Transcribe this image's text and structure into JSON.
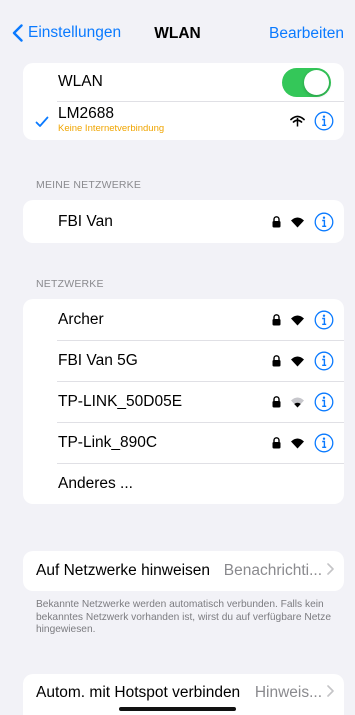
{
  "nav": {
    "back_label": "Einstellungen",
    "title": "WLAN",
    "edit_label": "Bearbeiten"
  },
  "wlan": {
    "label": "WLAN",
    "enabled": true
  },
  "connected": {
    "name": "LM2688",
    "status": "Keine Internetverbindung"
  },
  "my_networks": {
    "header": "MEINE NETZWERKE",
    "items": [
      {
        "name": "FBI Van"
      }
    ]
  },
  "networks": {
    "header": "NETZWERKE",
    "items": [
      {
        "name": "Archer"
      },
      {
        "name": "FBI Van 5G"
      },
      {
        "name": "TP-LINK_50D05E"
      },
      {
        "name": "TP-Link_890C"
      }
    ],
    "other_label": "Anderes ..."
  },
  "ask_join": {
    "label": "Auf Netzwerke hinweisen",
    "value": "Benachrichti...",
    "footer": "Bekannte Netzwerke werden automatisch verbunden. Falls kein bekanntes Netzwerk vorhanden ist, wirst du auf verfügbare Netze hingewiesen."
  },
  "hotspot": {
    "label": "Autom. mit Hotspot verbinden",
    "value": "Hinweis..."
  },
  "colors": {
    "accent": "#0a7aff",
    "toggle_on": "#34c759",
    "warning": "#f0a500",
    "background": "#f2f2f7"
  }
}
